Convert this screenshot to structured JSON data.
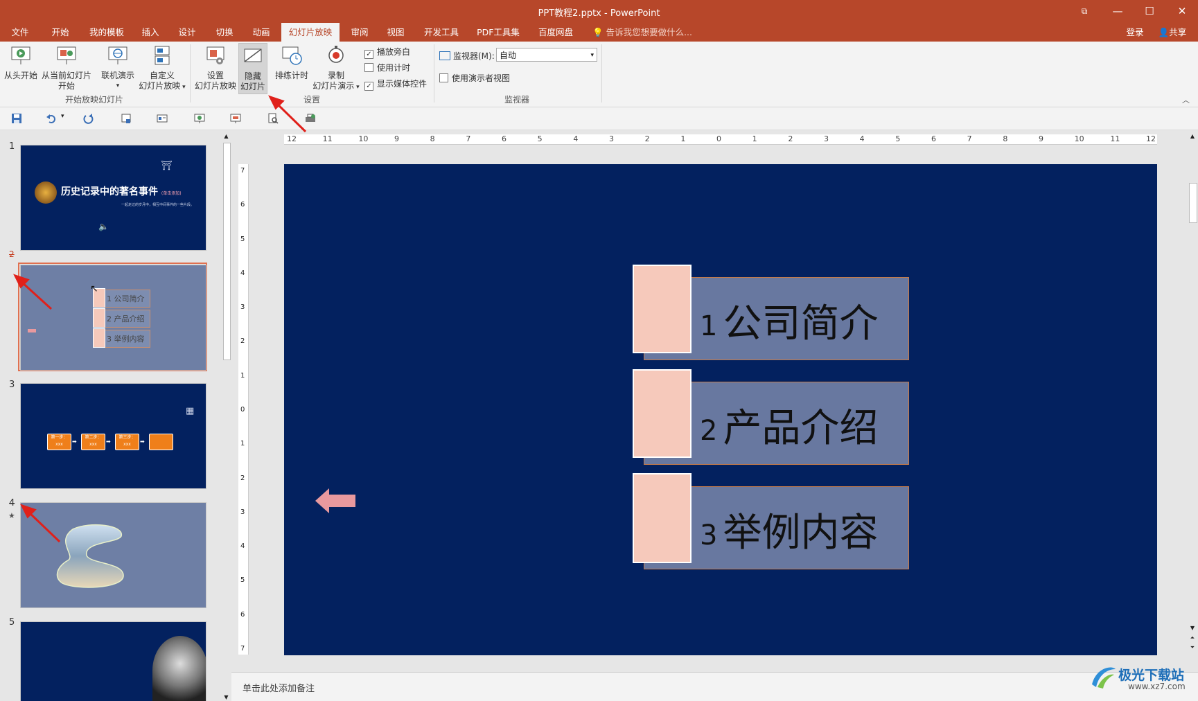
{
  "window": {
    "title": "PPT教程2.pptx - PowerPoint"
  },
  "tabs": [
    {
      "label": "文件"
    },
    {
      "label": "开始"
    },
    {
      "label": "我的模板"
    },
    {
      "label": "插入"
    },
    {
      "label": "设计"
    },
    {
      "label": "切换"
    },
    {
      "label": "动画"
    },
    {
      "label": "幻灯片放映"
    },
    {
      "label": "审阅"
    },
    {
      "label": "视图"
    },
    {
      "label": "开发工具"
    },
    {
      "label": "PDF工具集"
    },
    {
      "label": "百度网盘"
    }
  ],
  "active_tab": "幻灯片放映",
  "tell_me": "告诉我您想要做什么...",
  "login": "登录",
  "share": "共享",
  "ribbon": {
    "start_group": {
      "label": "开始放映幻灯片",
      "from_beginning": "从头开始",
      "from_current_l1": "从当前幻灯片",
      "from_current_l2": "开始",
      "online": "联机演示",
      "custom_l1": "自定义",
      "custom_l2": "幻灯片放映"
    },
    "setup_group": {
      "label": "设置",
      "setup_l1": "设置",
      "setup_l2": "幻灯片放映",
      "hide_l1": "隐藏",
      "hide_l2": "幻灯片",
      "rehearse": "排练计时",
      "record_l1": "录制",
      "record_l2": "幻灯片演示",
      "play_narration": "播放旁白",
      "use_timings": "使用计时",
      "show_media": "显示媒体控件",
      "play_narration_checked": true,
      "use_timings_checked": false,
      "show_media_checked": true
    },
    "monitor_group": {
      "label": "监视器",
      "monitor_label": "监视器(M):",
      "monitor_value": "自动",
      "presenter_view": "使用演示者视图",
      "presenter_view_checked": false
    }
  },
  "thumbnails": [
    {
      "num": "1",
      "title": "历史记录中的著名事件",
      "tag": "(单击添加)",
      "subtitle": "一起走过的岁月中，相互中间事件的一些片段。",
      "hidden": false
    },
    {
      "num": "2",
      "items": [
        "1 公司简介",
        "2 产品介绍",
        "3 举例内容"
      ],
      "hidden": true,
      "selected": true
    },
    {
      "num": "3",
      "steps": [
        "第一步：xxx",
        "第二步：xxx",
        "第三步：xxx",
        ""
      ],
      "hidden": false
    },
    {
      "num": "4",
      "hidden": true
    },
    {
      "num": "5",
      "hidden": false
    }
  ],
  "slide": {
    "items": [
      {
        "num": "1",
        "text": "公司简介"
      },
      {
        "num": "2",
        "text": "产品介绍"
      },
      {
        "num": "3",
        "text": "举例内容"
      }
    ],
    "back_arrow_color": "#e8999e",
    "background_color": "#03215f"
  },
  "hruler_labels": [
    "12",
    "11",
    "10",
    "9",
    "8",
    "7",
    "6",
    "5",
    "4",
    "3",
    "2",
    "1",
    "0",
    "1",
    "2",
    "3",
    "4",
    "5",
    "6",
    "7",
    "8",
    "9",
    "10",
    "11",
    "12"
  ],
  "vruler_labels": [
    "7",
    "6",
    "5",
    "4",
    "3",
    "2",
    "1",
    "0",
    "1",
    "2",
    "3",
    "4",
    "5",
    "6",
    "7"
  ],
  "notes_placeholder": "单击此处添加备注",
  "watermark": {
    "name": "极光下载站",
    "url": "www.xz7.com"
  },
  "accent_color": "#b7472a"
}
